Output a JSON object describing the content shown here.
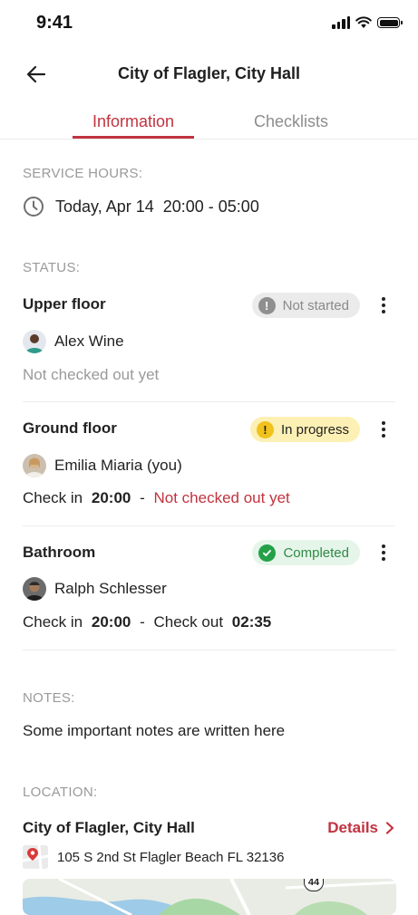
{
  "status_bar": {
    "time": "9:41"
  },
  "header": {
    "title": "City of Flagler, City Hall"
  },
  "tabs": [
    {
      "label": "Information",
      "active": true
    },
    {
      "label": "Checklists",
      "active": false
    }
  ],
  "service_hours": {
    "label": "SERVICE HOURS:",
    "value": "Today, Apr 14  20:00 - 05:00"
  },
  "status": {
    "label": "STATUS:",
    "areas": [
      {
        "name": "Upper floor",
        "badge": "Not started",
        "person": "Alex Wine",
        "line": "Not checked out yet"
      },
      {
        "name": "Ground floor",
        "badge": "In progress",
        "person": "Emilia Miaria (you)",
        "check_in_label": "Check in",
        "check_in_time": "20:00",
        "separator": "-",
        "check_out_text": "Not checked out yet"
      },
      {
        "name": "Bathroom",
        "badge": "Completed",
        "person": "Ralph Schlesser",
        "check_in_label": "Check in",
        "check_in_time": "20:00",
        "separator": "-",
        "check_out_label": "Check out",
        "check_out_time": "02:35"
      }
    ]
  },
  "notes": {
    "label": "NOTES:",
    "text": "Some important notes are written here"
  },
  "location": {
    "label": "LOCATION:",
    "name": "City of Flagler, City Hall",
    "details_label": "Details",
    "address": "105 S 2nd St Flagler Beach FL 32136"
  },
  "map": {
    "route_badge": "44"
  },
  "colors": {
    "accent": "#c1333f",
    "not_started": "#8f8f8f",
    "in_progress": "#f1c21b",
    "completed": "#24a148"
  }
}
